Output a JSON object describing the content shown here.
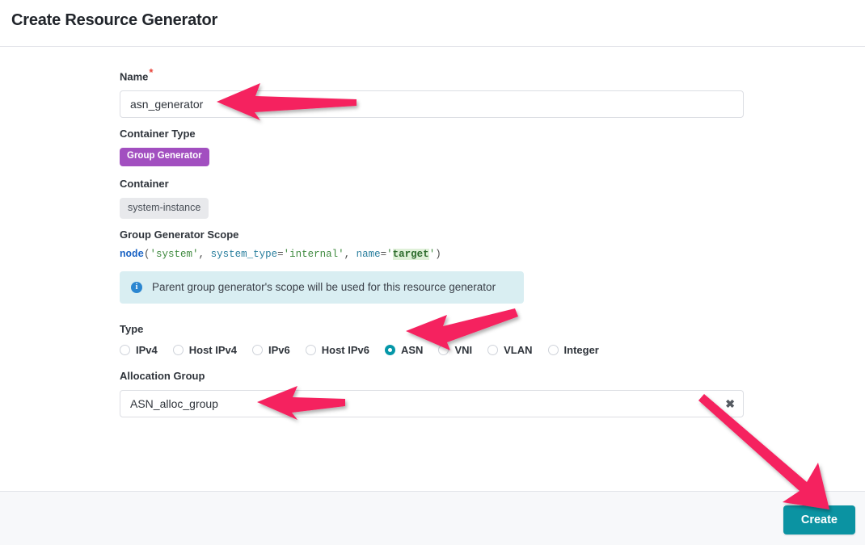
{
  "header": {
    "title": "Create Resource Generator"
  },
  "form": {
    "name": {
      "label": "Name",
      "required_marker": "*",
      "value": "asn_generator",
      "placeholder": ""
    },
    "container_type": {
      "label": "Container Type",
      "badge": "Group Generator",
      "badge_color": "#a24fc0"
    },
    "container": {
      "label": "Container",
      "chip": "system-instance",
      "chip_color": "#e8e9ec"
    },
    "group_generator_scope": {
      "label": "Group Generator Scope",
      "code_tokens": [
        {
          "text": "node",
          "kind": "fn"
        },
        {
          "text": "(",
          "kind": "punct"
        },
        {
          "text": "'system'",
          "kind": "str"
        },
        {
          "text": ", ",
          "kind": "punct"
        },
        {
          "text": "system_type",
          "kind": "kw"
        },
        {
          "text": "=",
          "kind": "op"
        },
        {
          "text": "'internal'",
          "kind": "str"
        },
        {
          "text": ", ",
          "kind": "punct"
        },
        {
          "text": "name",
          "kind": "kw"
        },
        {
          "text": "=",
          "kind": "op"
        },
        {
          "text": "'",
          "kind": "str"
        },
        {
          "text": "target",
          "kind": "hl"
        },
        {
          "text": "'",
          "kind": "str"
        },
        {
          "text": ")",
          "kind": "punct"
        }
      ],
      "code_plain": "node('system', system_type='internal', name='target')"
    },
    "info_alert": {
      "icon": "info-circle-icon",
      "text": "Parent group generator's scope will be used for this resource generator",
      "background": "#d9eef2",
      "icon_color": "#2b86d0"
    },
    "type": {
      "label": "Type",
      "selected": "ASN",
      "selected_color": "#0597a8",
      "options": [
        {
          "label": "IPv4",
          "selected": false
        },
        {
          "label": "Host IPv4",
          "selected": false
        },
        {
          "label": "IPv6",
          "selected": false
        },
        {
          "label": "Host IPv6",
          "selected": false
        },
        {
          "label": "ASN",
          "selected": true
        },
        {
          "label": "VNI",
          "selected": false
        },
        {
          "label": "VLAN",
          "selected": false
        },
        {
          "label": "Integer",
          "selected": false
        }
      ]
    },
    "allocation_group": {
      "label": "Allocation Group",
      "value": "ASN_alloc_group",
      "placeholder": "",
      "clear_icon": "clear-x-icon"
    }
  },
  "footer": {
    "create_label": "Create",
    "create_color": "#0b93a2"
  },
  "annotations": {
    "arrow_color": "#f5225e",
    "arrows": [
      {
        "name": "arrow-to-name-field",
        "points_to": "Name input"
      },
      {
        "name": "arrow-to-asn-radio",
        "points_to": "ASN radio option"
      },
      {
        "name": "arrow-to-allocation-group",
        "points_to": "Allocation Group input"
      },
      {
        "name": "arrow-to-create-button",
        "points_to": "Create button"
      }
    ]
  }
}
